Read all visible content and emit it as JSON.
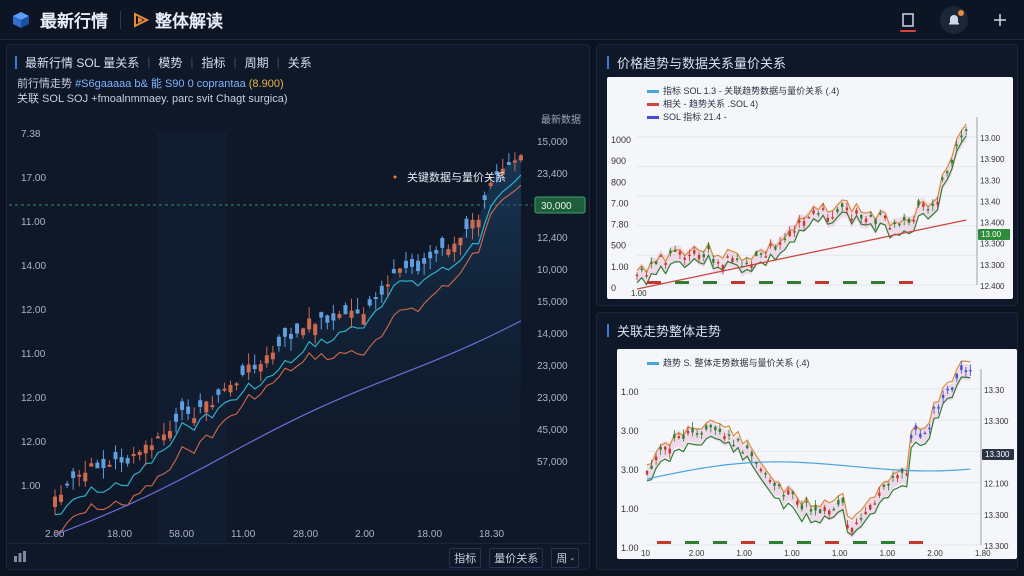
{
  "header": {
    "app_title": "最新行情",
    "tab_title": "整体解读",
    "accent_red": "#d6453d",
    "accent_blue": "#3a7bd5"
  },
  "main_panel": {
    "tabs": [
      "最新行情 SOL 量关系",
      "模势",
      "指标",
      "周期",
      "关系"
    ],
    "info_line1_prefix": "前行情走势",
    "info_line1_mid": "#S6gaaaaa b& 能 S90 0 coprantaa",
    "info_line1_val": "(8.900)",
    "info_line2": "关联 SOL SOJ +fmoalnmmaey. parc svit Chagt surgica)",
    "annotation": "关键数据与量价关系",
    "right_axis_title": "最新数据",
    "price_tag": "30,000",
    "bottom_tools": [
      "指标",
      "量价关系",
      "周 -"
    ],
    "y_left": [
      "7.38",
      "17.00",
      "11.00",
      "14.00",
      "12.00",
      "11.00",
      "12.00",
      "12.00",
      "1.00"
    ],
    "y_right": [
      "15,000",
      "23,400",
      "13,300",
      "12,400",
      "10,000",
      "15,000",
      "14,000",
      "23,000",
      "23,000",
      "45,000",
      "57,000"
    ],
    "x_ticks": [
      "2.00",
      "18.00",
      "58.00",
      "11.00",
      "28.00",
      "2.00",
      "18.00",
      "18.30"
    ]
  },
  "top_right_panel": {
    "title": "价格趋势与数据关系量价关系",
    "legend": [
      "指标 SOL 1.3 - 关联趋势数据与量价关系 (.4)",
      "相关 - 趋势关系 .SOL 4)",
      "SOL 指标 21.4 -"
    ],
    "y_left": [
      "1000",
      "900",
      "800",
      "7.00",
      "7.80",
      "500",
      "1.00",
      "0"
    ],
    "y_right": [
      "13.00",
      "13.900",
      "13.30",
      "13.40",
      "13.400",
      "13.300",
      "13.300",
      "12.400"
    ],
    "tag": "13.00",
    "x_label": "1.00"
  },
  "bottom_right_panel": {
    "title": "关联走势整体走势",
    "legend": "趋势 S. 整体走势数据与量价关系 (.4)",
    "y_left": [
      "1.00",
      "3.00",
      "3.00",
      "1.00",
      "1.00"
    ],
    "y_right": [
      "13.30",
      "13.300",
      "13.300",
      "12.100",
      "13.300",
      "13.300"
    ],
    "tag": "13.300",
    "x_ticks": [
      "10",
      "2.00",
      "1.00",
      "1.00",
      "1.00",
      "1.00",
      "2.00",
      "1.80"
    ]
  }
}
